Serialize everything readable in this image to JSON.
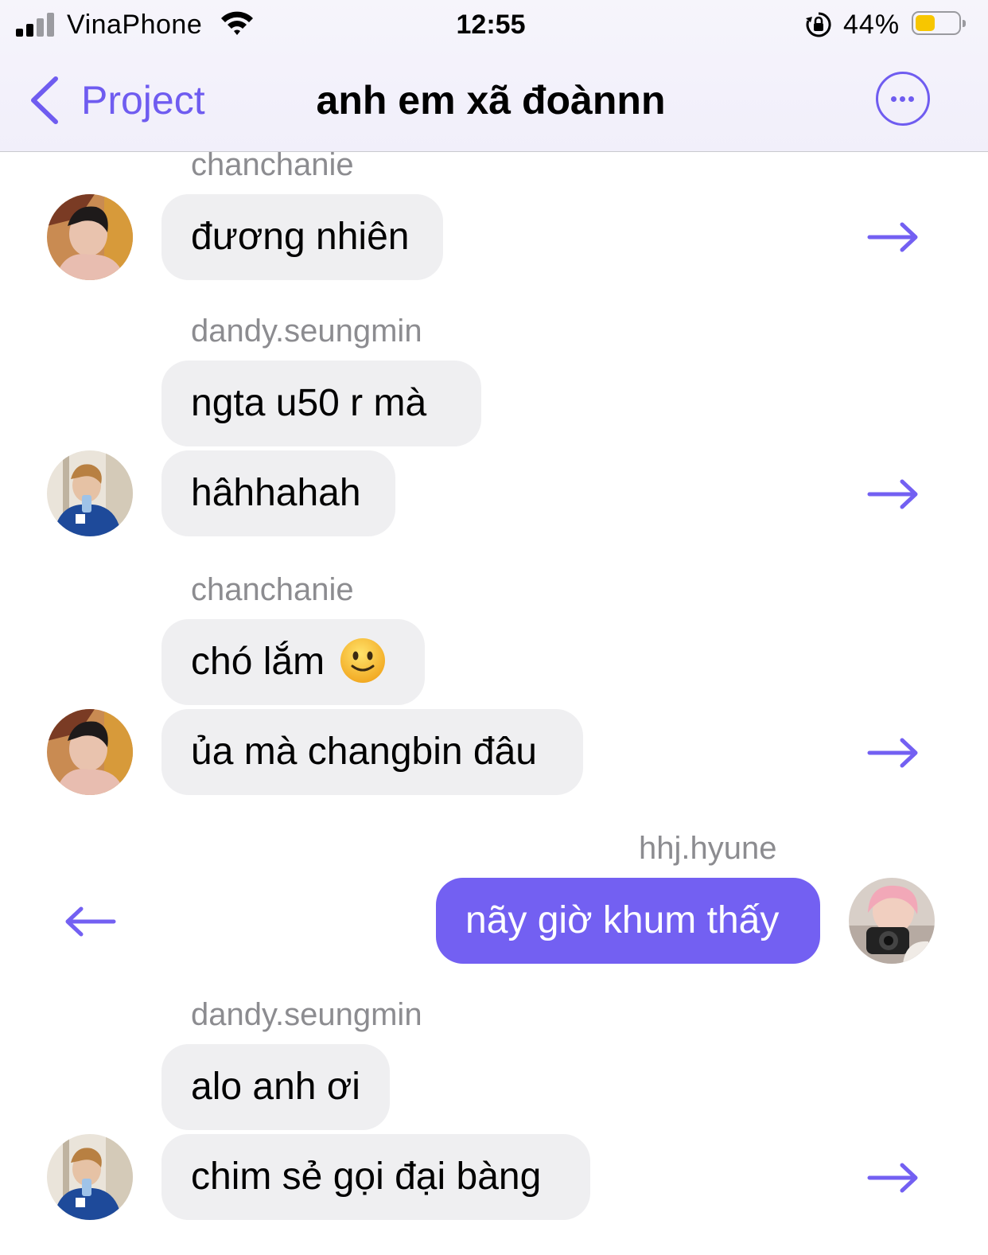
{
  "status_bar": {
    "carrier": "VinaPhone",
    "time": "12:55",
    "battery_percent": "44%",
    "battery_level": 0.44,
    "battery_color": "#f7c600"
  },
  "nav": {
    "back_label": "Project",
    "title": "anh em xã đoànnn",
    "more_icon": "ellipsis-circle-icon"
  },
  "accent_color": "#7360f2",
  "messages": [
    {
      "sender": "chanchanie",
      "bubbles": [
        "đương nhiên"
      ],
      "action_icon": "arrow-right-icon"
    },
    {
      "sender": "dandy.seungmin",
      "bubbles": [
        "ngta u50 r mà",
        "hâhhahah"
      ],
      "action_icon": "arrow-right-icon"
    },
    {
      "sender": "chanchanie",
      "bubbles": [
        "chó lắm",
        "ủa mà changbin đâu"
      ],
      "emoji": "slightly-smiling-face-icon",
      "action_icon": "arrow-right-icon"
    },
    {
      "sender": "hhj.hyune",
      "bubbles": [
        "nãy giờ khum thấy"
      ],
      "outgoing": true,
      "action_icon": "arrow-left-icon"
    },
    {
      "sender": "dandy.seungmin",
      "bubbles": [
        "alo anh ơi",
        "chim sẻ gọi đại bàng"
      ],
      "action_icon": "arrow-right-icon"
    }
  ]
}
